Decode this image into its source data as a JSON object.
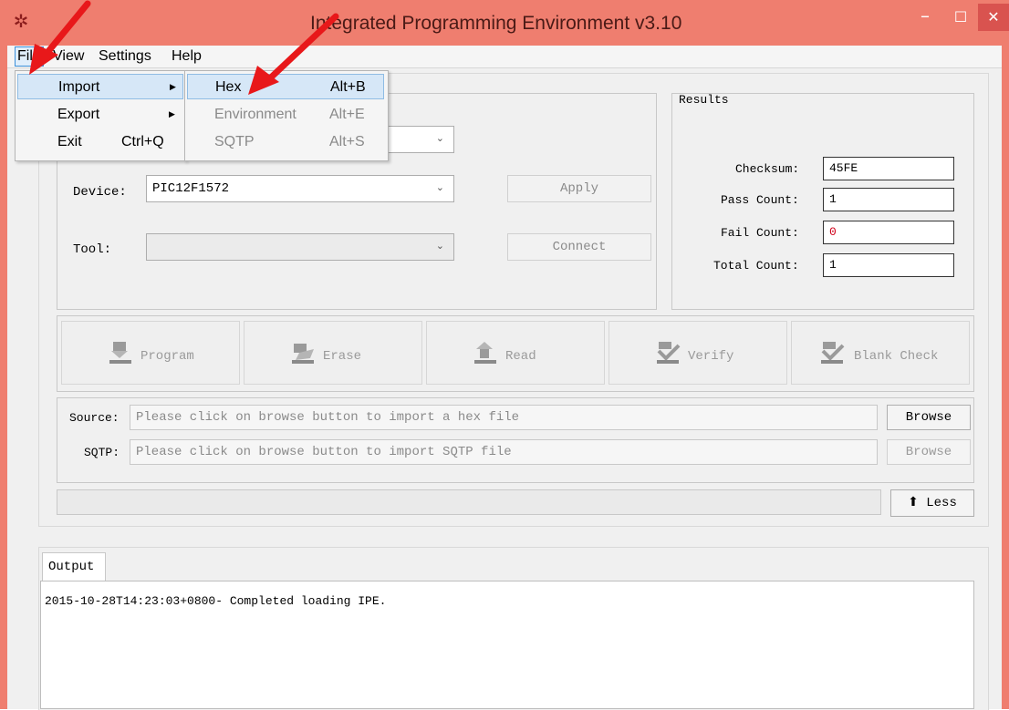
{
  "window": {
    "title": "Integrated Programming Environment v3.10"
  },
  "menubar": {
    "items": [
      "File",
      "View",
      "Settings",
      "Help"
    ]
  },
  "file_menu": {
    "items": [
      {
        "label": "Import",
        "shortcut": "",
        "submenu": true
      },
      {
        "label": "Export",
        "shortcut": "",
        "submenu": true
      },
      {
        "label": "Exit",
        "shortcut": "Ctrl+Q",
        "submenu": false
      }
    ]
  },
  "import_submenu": {
    "items": [
      {
        "label": "Hex",
        "shortcut": "Alt+B",
        "enabled": true
      },
      {
        "label": "Environment",
        "shortcut": "Alt+E",
        "enabled": false
      },
      {
        "label": "SQTP",
        "shortcut": "Alt+S",
        "enabled": false
      }
    ]
  },
  "device_settings": {
    "device_label": "Device:",
    "device_value": "PIC12F1572",
    "tool_label": "Tool:",
    "tool_value": "",
    "apply_label": "Apply",
    "connect_label": "Connect"
  },
  "results": {
    "title": "Results",
    "checksum_label": "Checksum:",
    "checksum_value": "45FE",
    "pass_label": "Pass Count:",
    "pass_value": "1",
    "fail_label": "Fail Count:",
    "fail_value": "0",
    "total_label": "Total Count:",
    "total_value": "1"
  },
  "actions": {
    "program": "Program",
    "erase": "Erase",
    "read": "Read",
    "verify": "Verify",
    "blank_check": "Blank Check"
  },
  "source": {
    "source_label": "Source:",
    "source_placeholder": "Please click on browse button to import a hex file",
    "sqtp_label": "SQTP:",
    "sqtp_placeholder": "Please click on browse button to import SQTP file",
    "browse_label": "Browse",
    "less_label": "⬆ Less"
  },
  "output": {
    "tab_label": "Output",
    "log": "2015-10-28T14:23:03+0800- Completed loading IPE."
  },
  "colors": {
    "title_bar": "#ef7e6f",
    "arrow": "#e8181a",
    "fail_text": "#d0021b"
  }
}
